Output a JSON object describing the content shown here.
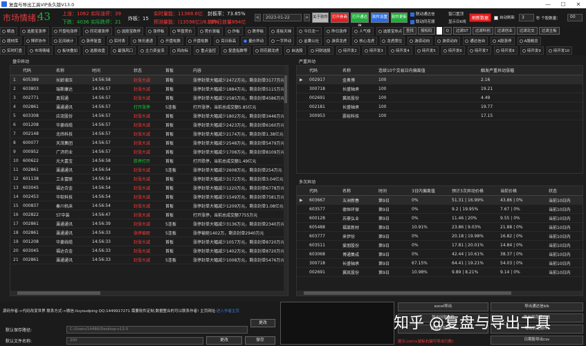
{
  "window": {
    "title": "复盘与导出工具VIP永久版V13.0",
    "controls": [
      "—",
      "☐",
      "✕"
    ]
  },
  "header": {
    "market_label": "市场情绪：",
    "market_value": "43",
    "limit_up": "上涨：1062 实际涨停：39",
    "limit_down": "下跌：4036 实际跌停：21",
    "zhaban": "炸板：15",
    "volume": "实时量能：11368.6亿",
    "volume_change": "较昨日放量894亿",
    "seal_rate": "封板率：73.85%",
    "pred_volume": "预测量能：(13598亿)/6.76%",
    "date": "2023-01-22",
    "prev": "<",
    "next": ">",
    "buttons": [
      {
        "label": "关于软件",
        "color": "#b8b8b8"
      },
      {
        "label": "打开券商",
        "color": "#e02020"
      },
      {
        "label": "打开通达信",
        "color": "#1fae3a"
      },
      {
        "label": "软件设置",
        "color": "#2d6cdf"
      },
      {
        "label": "软件更新",
        "color": "#1fae3a"
      }
    ],
    "check_lianxu": "联动通达信",
    "check_tonghuashun": "联动同花顺",
    "window_top": "窗口置顶",
    "show_kline": "显示日K线",
    "refresh": "刷新数据",
    "auto_refresh": "自动刷新",
    "interval_value": "3",
    "seconds_label": "秒 个股数量：",
    "stock_count": "00"
  },
  "filters": {
    "row1": [
      {
        "label": "精选",
        "on": false
      },
      {
        "label": "选股宝涨停",
        "on": false
      },
      {
        "label": "开盘啦涨停",
        "on": false
      },
      {
        "label": "同花顺涨停",
        "on": false
      },
      {
        "label": "选股宝跌停",
        "on": false
      },
      {
        "label": "涨停板",
        "on": false
      },
      {
        "label": "早盘竞价",
        "on": false
      },
      {
        "label": "竞价涨幅",
        "on": false
      },
      {
        "label": "炸板",
        "on": false
      },
      {
        "label": "跌停板",
        "on": false
      },
      {
        "label": "连板天梯",
        "on": false
      },
      {
        "label": "今日龙一",
        "on": false
      },
      {
        "label": "昨日涨停",
        "on": false
      },
      {
        "label": "人气榜",
        "on": false
      },
      {
        "label": "选股宝热点",
        "on": false
      }
    ],
    "search_btn": "查找",
    "range_btn": "授权码",
    "s_btn": "Q",
    "filter_btns": [
      "过滤ST",
      "过滤科创",
      "过滤创业",
      "过滤北交",
      "过滤主板"
    ],
    "row2": [
      {
        "label": "题材库",
        "on": false
      },
      {
        "label": "博弈协作",
        "on": false
      },
      {
        "label": "区间统计",
        "on": false
      },
      {
        "label": "涨停复盘",
        "on": false
      },
      {
        "label": "实时表",
        "on": false
      },
      {
        "label": "快讯速递",
        "on": false
      },
      {
        "label": "开盘啦数",
        "on": false
      },
      {
        "label": "开盘啦数",
        "on": false
      },
      {
        "label": "百日新高",
        "on": false
      },
      {
        "label": "量价异动",
        "on": true
      },
      {
        "label": "一字异动",
        "on": false
      },
      {
        "label": "金鹰公社",
        "on": false
      },
      {
        "label": "游资龙虎",
        "on": false
      },
      {
        "label": "核心龙虎",
        "on": false
      },
      {
        "label": "龙虎席位",
        "on": false
      },
      {
        "label": "游资动向",
        "on": false
      },
      {
        "label": "游资动向",
        "on": false
      },
      {
        "label": "通达信自",
        "on": false
      },
      {
        "label": "A股涨停",
        "on": false
      },
      {
        "label": "A股概念",
        "on": false
      }
    ],
    "row3": [
      {
        "label": "实时盯盘",
        "on": false
      },
      {
        "label": "市场情绪",
        "on": false
      },
      {
        "label": "板块叠加",
        "on": false
      },
      {
        "label": "选股收盘",
        "on": false
      },
      {
        "label": "最强风口",
        "on": false
      },
      {
        "label": "主力资金流",
        "on": false
      },
      {
        "label": "风向标",
        "on": false
      },
      {
        "label": "重点监控",
        "on": false
      },
      {
        "label": "复盘指数等",
        "on": false
      },
      {
        "label": "同花顺龙虎",
        "on": false
      },
      {
        "label": "自选股",
        "on": false
      },
      {
        "label": "问财选股",
        "on": false
      },
      {
        "label": "待开发2",
        "on": false
      },
      {
        "label": "待开发3",
        "on": false
      },
      {
        "label": "待开发4",
        "on": false
      },
      {
        "label": "待开发5",
        "on": false
      },
      {
        "label": "待开发6",
        "on": false
      },
      {
        "label": "待开发7",
        "on": false
      },
      {
        "label": "待开发8",
        "on": false
      },
      {
        "label": "待开发9",
        "on": false
      },
      {
        "label": "待开发10",
        "on": false
      }
    ]
  },
  "left_panel": {
    "title": "盘中异动",
    "columns": [
      "",
      "代码",
      "名称",
      "时间",
      "状态",
      "首板",
      "内容"
    ],
    "rows": [
      [
        "1",
        "605389",
        "长龄液压",
        "14:56:58",
        "封涨大减",
        "首板",
        "涨停封单大幅减少2472万元，剩余封单3177万元"
      ],
      [
        "2",
        "603803",
        "瑞斯康达",
        "14:56:57",
        "封涨大减",
        "首板",
        "涨停封单大幅减少1884万元，剩余封单5115万元"
      ],
      [
        "3",
        "002771",
        "真视通",
        "14:56:57",
        "封涨大减",
        "首板",
        "涨停封单大幅减少2585万元，剩余封单4586万元"
      ],
      [
        "4",
        "002861",
        "瀛通通讯",
        "14:56:57",
        "打开涨停",
        "5连板",
        "打开涨停，当前总成交额5.85亿元"
      ],
      [
        "5",
        "603308",
        "应流股份",
        "14:56:57",
        "封涨大减",
        "首板",
        "涨停封单大幅减少1802万元，剩余封单3446万元"
      ],
      [
        "6",
        "001208",
        "华菱线缆",
        "14:56:57",
        "封涨大减",
        "首板",
        "涨停封单大幅减少2423万元，剩余封单6160万元"
      ],
      [
        "7",
        "002148",
        "北纬科技",
        "14:56:57",
        "封涨大减",
        "首板",
        "涨停封单大幅减少2174万元，剩余封单1.38亿元"
      ],
      [
        "8",
        "600077",
        "天茂集团",
        "14:56:57",
        "封涨大减",
        "首板",
        "涨停封单大幅减少2548万元，剩余封单5479万元"
      ],
      [
        "9",
        "000952",
        "广济药业",
        "14:56:57",
        "封涨大减",
        "首板",
        "涨停封单大幅减少1708万元，剩余封单8109万元"
      ],
      [
        "10",
        "600622",
        "光大嘉宝",
        "14:56:58",
        "跌停打开",
        "首板",
        "打开跌停，当前总成交额1.49亿元"
      ],
      [
        "11",
        "002861",
        "瀛通通讯",
        "14:56:54",
        "封涨大减",
        "5连板",
        "涨停封单大幅减少2608万元，剩余封单254万元"
      ],
      [
        "12",
        "601138",
        "工业富联",
        "14:56:54",
        "封涨大减",
        "首板",
        "涨停封单大幅减少3172万元，剩余封单3.04亿元"
      ],
      [
        "13",
        "603045",
        "福达合金",
        "14:56:54",
        "封涨大减",
        "首板",
        "涨停封单大幅减少1220万元，剩余封单6778万元"
      ],
      [
        "14",
        "002453",
        "华软科技",
        "14:56:54",
        "封涨大减",
        "首板",
        "涨停封单大幅减少1549万元，剩余封单7581万元"
      ],
      [
        "15",
        "000837",
        "秦川机床",
        "14:56:54",
        "封涨大减",
        "首板",
        "涨停封单大幅减少1209万元，剩余封单1.08亿元"
      ],
      [
        "16",
        "002822",
        "ST中装",
        "14:56:47",
        "封涨大减",
        "首板",
        "打开涨停，当前总成交额7755万元"
      ],
      [
        "17",
        "002861",
        "瀛通通讯",
        "14:56:39",
        "封涨大减",
        "5连板",
        "涨停封单大幅减少3136万元，剩余封单2340万元"
      ],
      [
        "18",
        "002861",
        "瀛通通讯",
        "14:56:33",
        "涨停被砸",
        "5连板",
        "涨停被砸1402万，剩余封单2940万元"
      ],
      [
        "19",
        "001208",
        "华菱线缆",
        "14:56:33",
        "封涨大减",
        "首板",
        "涨停封单大幅减少1057万元，剩余封单8720万元"
      ],
      [
        "20",
        "603045",
        "福达合金",
        "14:56:33",
        "封涨大减",
        "首板",
        "涨停封单大幅减少1402万元，剩余封单8720万元"
      ],
      [
        "21",
        "002861",
        "瀛通通讯",
        "14:56:33",
        "封涨大减",
        "5连板",
        "涨停封单大幅减少1008万元，剩余封单5476万元"
      ]
    ]
  },
  "right_top": {
    "title": "严重异动",
    "columns": [
      "",
      "代码",
      "名称",
      "连续10个交易日内偏离值",
      "触发严重异动涨幅"
    ],
    "rows": [
      [
        "▶",
        "002917",
        "金奥博",
        "100",
        "2.16"
      ],
      [
        "",
        "300718",
        "长盛轴承",
        "100",
        "19.21"
      ],
      [
        "",
        "002691",
        "冀凯股份",
        "100",
        "4.49"
      ],
      [
        "",
        "002181",
        "长盛轴承",
        "100",
        "19.77"
      ],
      [
        "",
        "300953",
        "震裕科技",
        "100",
        "17.15"
      ]
    ]
  },
  "right_bottom": {
    "title": "多次异动",
    "columns": [
      "",
      "代码",
      "名称",
      "时间",
      "3日内偏离值",
      "预计3次异动价格",
      "当前价格",
      "状态"
    ],
    "rows": [
      [
        "▶",
        "603667",
        "五洲新春",
        "第9日",
        "0%",
        "51.31 | 16.99%",
        "43.86 | 0%",
        "当前10日内"
      ],
      [
        "",
        "603577",
        "德恒环保",
        "第9日",
        "0%",
        "9.2 | 19.95%",
        "7.67 | 0%",
        "当前10日内"
      ],
      [
        "",
        "600128",
        "苏豪弘业",
        "第9日",
        "0%",
        "11.46 | 20%",
        "9.55 | 0%",
        "当前10日内"
      ],
      [
        "",
        "605488",
        "福莱新材",
        "第9日",
        "10.91%",
        "23.86 | 9.03%",
        "21.88 | 0%",
        "当前10日内"
      ],
      [
        "",
        "603777",
        "来伊份",
        "第9日",
        "0%",
        "20.18 | 19.98%",
        "16.82 | 0%",
        "当前10日内"
      ],
      [
        "",
        "603511",
        "爱朋股份",
        "第9日",
        "0%",
        "17.81 | 20.01%",
        "14.84 | 0%",
        "当前10日内"
      ],
      [
        "",
        "603068",
        "博通集成",
        "第9日",
        "0%",
        "42.44 | 10.61%",
        "38.37 | 0%",
        "当前10日内"
      ],
      [
        "",
        "300718",
        "长盛轴承",
        "第9日",
        "67.15%",
        "64.41 | 19.21%",
        "54.03 | 0%",
        "当前10日内"
      ],
      [
        "",
        "002691",
        "冀凯股份",
        "第9日",
        "10.98%",
        "9.89 | 8.21%",
        "9.14 | 0%",
        "当前10日内"
      ]
    ]
  },
  "bottom": {
    "author_line": "源码作者->代码改变世界  联系方式->微信:liuyoudping QQ:1449917271  需要软件定制,数据整合的可以联系作者! 主页网址:",
    "author_link": "进入作者主页",
    "save_path_label": "默认保存路径:",
    "save_path_value": "C:/Users/14486/Desktop-v13.0",
    "change_btn": "更改",
    "file_name_label": "默认文件名称:",
    "file_name_value": "200",
    "rename_btn": "更改",
    "save_btn": "保存",
    "export_buttons": [
      "excel导出",
      "导出通达信blk",
      "导出问财文件",
      "导出同花顺自选",
      "按板块导出blk",
      "导出同花顺txt",
      "日期股导出csv"
    ],
    "note": "提示:(ctrl+鼠标右键可导出行数)",
    "watermark": "知乎 @复盘与导出工具"
  }
}
